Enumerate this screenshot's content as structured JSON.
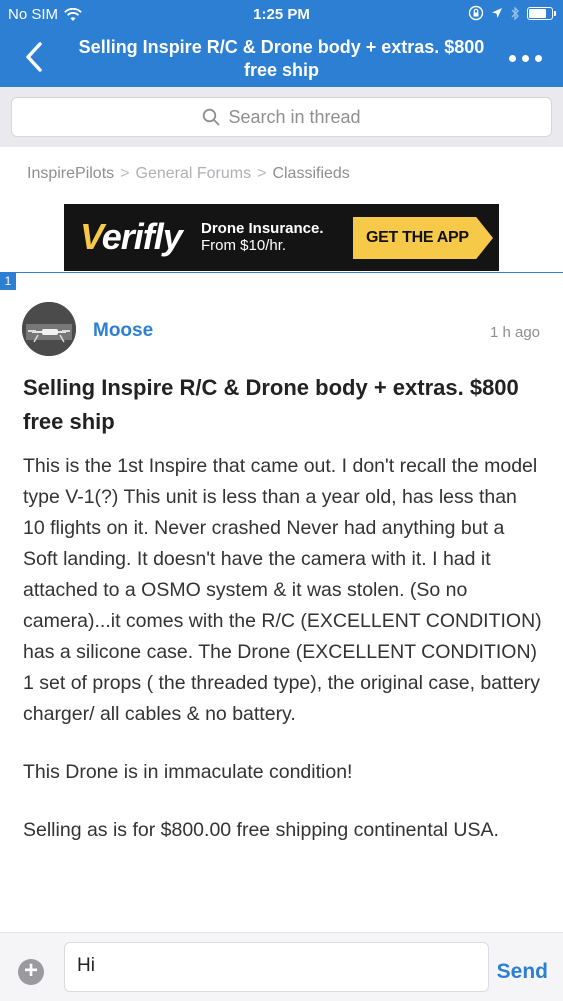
{
  "status_bar": {
    "carrier": "No SIM",
    "time": "1:25 PM",
    "battery_level": 0.85
  },
  "nav": {
    "back_icon": "chevron-left-icon",
    "title": "Selling Inspire R/C & Drone body + extras. $800 free ship",
    "more_icon": "ellipsis-icon"
  },
  "search": {
    "placeholder": "Search in thread",
    "icon": "search-icon"
  },
  "breadcrumb": {
    "items": [
      "InspirePilots",
      "General Forums",
      "Classifieds"
    ],
    "separator": ">"
  },
  "ad": {
    "brand": "Verifly",
    "headline": "Drone Insurance.",
    "subline": "From $10/hr.",
    "cta": "GET THE APP",
    "accent_color": "#f7c948"
  },
  "post": {
    "index": "1",
    "author": "Moose",
    "timestamp": "1 h ago",
    "title": "Selling Inspire R/C & Drone body + extras. $800 free ship",
    "paragraphs": [
      "This is the 1st Inspire that came out. I don't recall the model type V-1(?) This unit is less than a year old, has less than 10 flights on it. Never crashed Never had anything but a Soft landing. It doesn't have the camera with it. I had it attached to a OSMO system & it was stolen. (So no camera)...it comes with the R/C (EXCELLENT CONDITION) has a silicone case. The Drone (EXCELLENT CONDITION) 1 set of props ( the threaded type), the original case, battery charger/ all cables & no battery.",
      "This Drone is in  immaculate condition!",
      "Selling as is for $800.00 free shipping continental USA."
    ]
  },
  "composer": {
    "attach_icon": "plus-circle-icon",
    "input_value": "Hi",
    "send_label": "Send"
  },
  "colors": {
    "brand_blue": "#2d7fd3",
    "search_bg": "#e9e9ee"
  }
}
